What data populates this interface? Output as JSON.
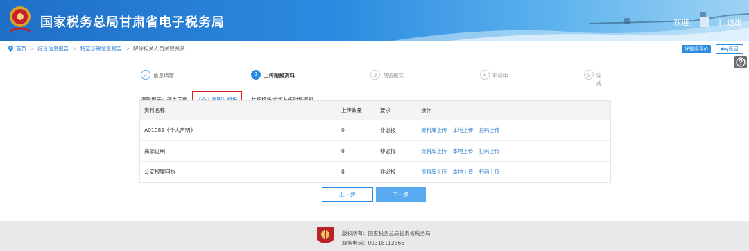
{
  "header": {
    "title": "国家税务总局甘肃省电子税务局",
    "welcome": "欢迎，",
    "logout": "退出",
    "separator": "|",
    "brand_color": "#2b8be0"
  },
  "breadcrumb": {
    "items": [
      "首页",
      "综合信息报告",
      "特定涉税信息报告",
      "解除相关人员关联关系"
    ],
    "separator": ">"
  },
  "actions": {
    "evaluate": "好差评评价",
    "back": "返回"
  },
  "steps": [
    {
      "num": "✓",
      "label": "信息填写",
      "state": "done"
    },
    {
      "num": "2",
      "label": "上传附报资料",
      "state": "active"
    },
    {
      "num": "3",
      "label": "预览提交",
      "state": "pending"
    },
    {
      "num": "4",
      "label": "审核中",
      "state": "pending"
    },
    {
      "num": "5",
      "label": "完成",
      "state": "pending"
    }
  ],
  "tip": {
    "prefix": "温馨提示：请先下载",
    "link": "《个人声明》模板",
    "suffix": "，并按模板格式上传附报资料。"
  },
  "table": {
    "headers": [
      "资料名称",
      "上传数量",
      "要求",
      "操作"
    ],
    "rows": [
      {
        "name": "A01082《个人声明》",
        "count": "0",
        "req": "非必报",
        "ops": [
          "资料库上传",
          "本地上传",
          "扫码上传"
        ]
      },
      {
        "name": "离职证明",
        "count": "0",
        "req": "非必报",
        "ops": [
          "资料库上传",
          "本地上传",
          "扫码上传"
        ]
      },
      {
        "name": "公安报案回执",
        "count": "0",
        "req": "非必报",
        "ops": [
          "资料库上传",
          "本地上传",
          "扫码上传"
        ]
      }
    ]
  },
  "buttons": {
    "prev": "上一步",
    "next": "下一步"
  },
  "footer": {
    "copyright": "版权所有：国家税务总局甘肃省税务局",
    "phone": "服务电话：09318112366"
  }
}
